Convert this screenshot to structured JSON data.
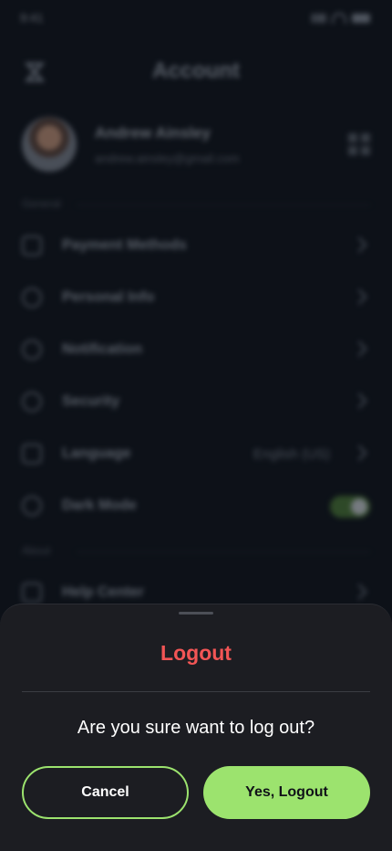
{
  "status_bar": {
    "time": "9:41"
  },
  "header": {
    "title": "Account",
    "logo_icon": "app-logo-icon"
  },
  "profile": {
    "name": "Andrew Ainsley",
    "email": "andrew.ainsley@gmail.com"
  },
  "sections": {
    "general_label": "General",
    "about_label": "About"
  },
  "menu": {
    "payment": "Payment Methods",
    "personal": "Personal Info",
    "notification": "Notification",
    "security": "Security",
    "language": "Language",
    "language_value": "English (US)",
    "dark_mode": "Dark Mode",
    "dark_mode_on": true,
    "help": "Help Center"
  },
  "dialog": {
    "title": "Logout",
    "message": "Are you sure want to log out?",
    "cancel_label": "Cancel",
    "confirm_label": "Yes, Logout"
  },
  "colors": {
    "accent": "#9ce36e",
    "danger": "#f25555",
    "sheet_bg": "#1c1d22"
  }
}
